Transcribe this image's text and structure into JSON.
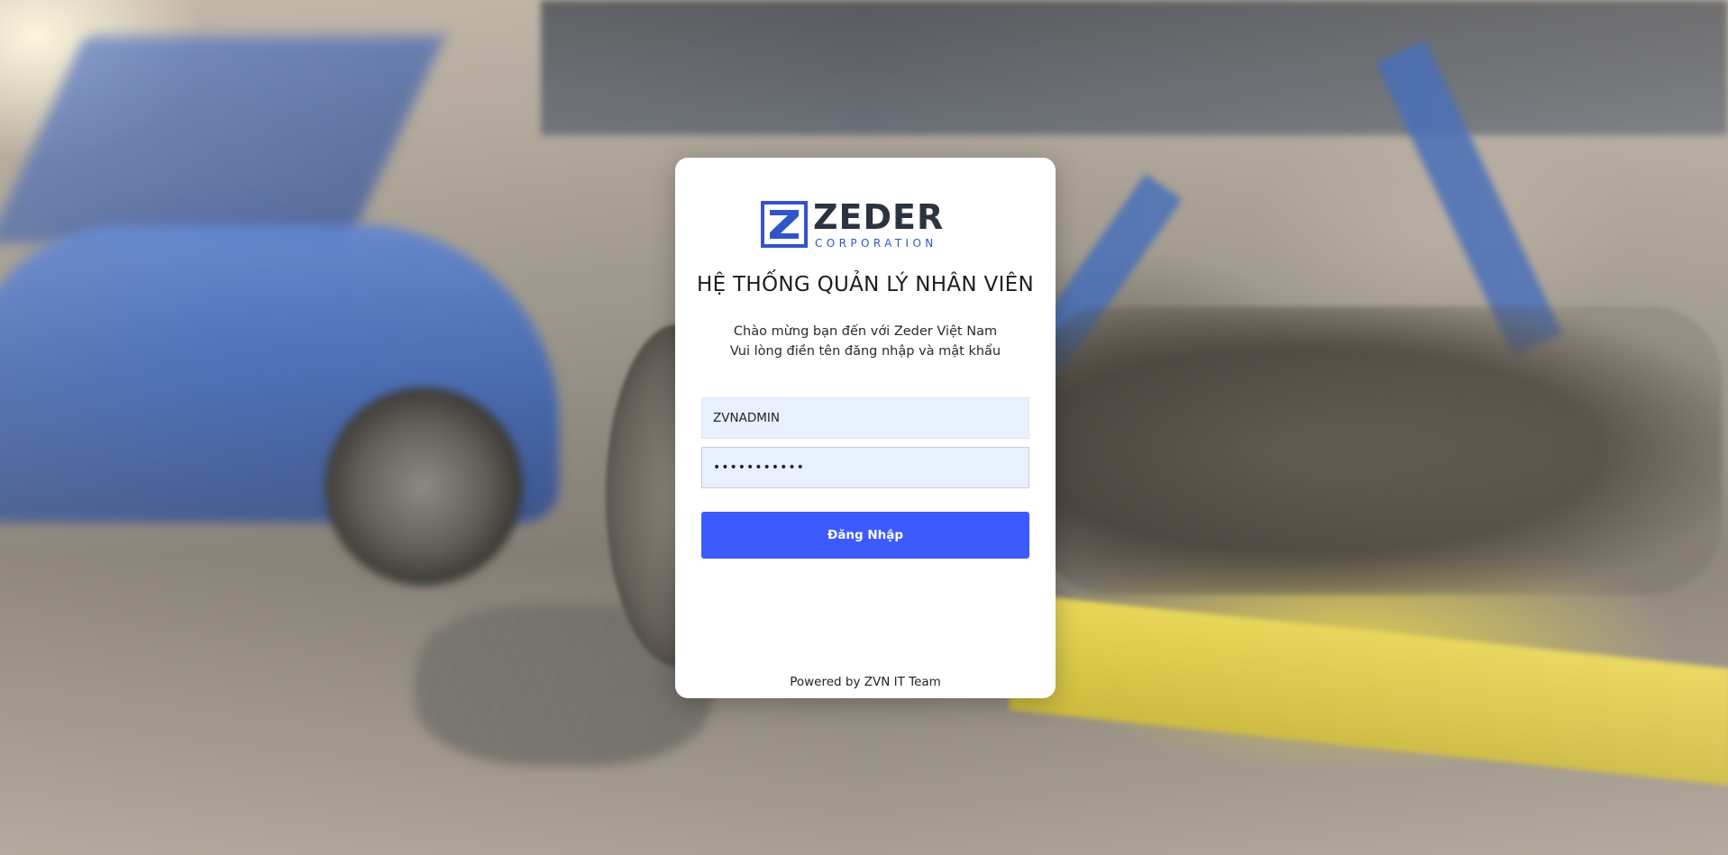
{
  "brand": {
    "name": "ZEDER",
    "sub": "CORPORATION",
    "logo_icon": "zeder-z-logo-icon",
    "colors": {
      "mark": "#3055c9",
      "name": "#2b3340"
    }
  },
  "login": {
    "title": "HỆ THỐNG QUẢN LÝ NHÂN VIÊN",
    "welcome_line1": "Chào mừng bạn đến với Zeder Việt Nam",
    "welcome_line2": "Vui lòng điền tên đăng nhập và mật khẩu",
    "username_value": "ZVNADMIN",
    "password_value": "•••••••••••",
    "submit_label": "Đăng Nhập",
    "submit_color": "#3d5afe"
  },
  "footer": {
    "text": "Powered by ZVN IT Team"
  }
}
